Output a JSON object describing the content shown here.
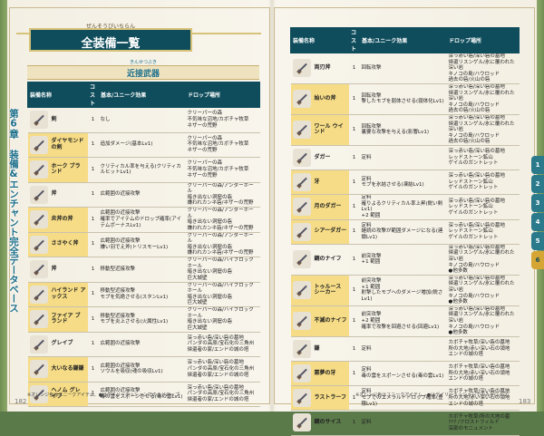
{
  "chapter_label": "第6章 装備&エンチャント完全データベース",
  "title": {
    "ruby": "ぜんそうびいちらん",
    "text": "全装備一覧"
  },
  "section": {
    "ruby": "きんせつぶき",
    "text": "近接武器"
  },
  "headers": [
    "装備名称",
    "コスト",
    "基本/ユニーク効果",
    "ドロップ場所"
  ],
  "left_rows": [
    {
      "name": "剣",
      "cost": "1",
      "effect": "なし",
      "drop": "クリーパーの森\n不気味な沼地/カボチャ牧草\nネザーの荒野",
      "hl": false
    },
    {
      "name": "ダイヤモンドの剣",
      "cost": "1",
      "effect": "追加ダメージ(基本Lv1)",
      "drop": "クリーパーの森\n不気味な沼地/カボチャ牧草\nネザーの荒野",
      "hl": true
    },
    {
      "name": "ホーク ブランド",
      "cost": "1",
      "effect": "クリティカル率を与える(クリティカルヒットLv1)",
      "drop": "クリーパーの森\n不気味な沼地/カボチャ牧草\nネザーの荒野",
      "hl": true
    },
    {
      "name": "斧",
      "cost": "1",
      "effect": "広範囲の近接攻撃",
      "drop": "クリーパーの森/アンダーホール\n暗き出ない洞窟の砦\n嫌われカンネ砦/ネザーの荒野",
      "hl": false
    },
    {
      "name": "炎斧の斧",
      "cost": "1",
      "effect": "広範囲の近接攻撃\n確率でアイテムのドロップ確率(アイテムボーナスLv1)",
      "drop": "クリーパーの森/アンダーホール\n暗き出ない洞窟の砦\n嫌われカンネ砦/ネザーの荒野",
      "hl": true
    },
    {
      "name": "ささやく斧",
      "cost": "1",
      "effect": "広範囲の近接攻撃\n嫌い羽でえ斧(トリスモーLv1)",
      "drop": "クリーパーの森/アンダーホール\n暗き出ない洞窟の砦\n嫌われカンネ砦/ネザーの荒野",
      "hl": true
    },
    {
      "name": "斧",
      "cost": "1",
      "effect": "移動型近接攻撃",
      "drop": "クリーパーの森/ハイブロックホール\n暗き出ない洞窟の砦\n巨大城壁",
      "hl": false
    },
    {
      "name": "ハイランド アックス",
      "cost": "1",
      "effect": "移動型近接攻撃\nモブを気絶させる(スタンLv1)",
      "drop": "クリーパーの森/ハイブロックホール\n暗き出ない洞窟の砦\n巨大城壁",
      "hl": true
    },
    {
      "name": "ファイア ブランド",
      "cost": "1",
      "effect": "移動型近接攻撃\nモブを炎上させる(火属性Lv1)",
      "drop": "クリーパーの森/ハイブロックホール\n暗き出ない洞窟の砦\n巨大城壁",
      "hl": true
    },
    {
      "name": "グレイブ",
      "cost": "1",
      "effect": "広範囲の近接攻撃",
      "drop": "深っ赤い砦/深い砦の墓地\nパンダの高原/宝石化の三角州\n帰還者の家/エンドの城の塔",
      "hl": false
    },
    {
      "name": "大いなる鎌鎌",
      "cost": "1",
      "effect": "広範囲の近接攻撃\nソウルを吸収(魂の吸収Lv1)",
      "drop": "深っ赤い砦/深い砦の墓地\nパンダの高原/宝石化の三角州\n帰還者の家/エンドの城の塔",
      "hl": true
    },
    {
      "name": "ヘノム グレイブ",
      "cost": "1",
      "effect": "広範囲の近接攻撃\n毒の雲をスポーンさせる(毒の雲Lv1)",
      "drop": "深っ赤い砦/深い砦の墓地\nパンダの高原/宝石化の三角州\n帰還者の家/エンドの城の塔",
      "hl": true
    }
  ],
  "right_rows": [
    {
      "name": "両刃斧",
      "cost": "1",
      "effect": "回転攻撃",
      "drop": "深っ赤い砦/深い砦の墓地\n帰還リスンゲル/氷に覆われた深い岩\nキノコの島/ハウロッド\n過去の砦/火山の砦",
      "hl": false
    },
    {
      "name": "始いの斧",
      "cost": "1",
      "effect": "回転攻撃\n撃したモブを弱体させる(弱体化Lv1)",
      "drop": "深っ赤い砦/深い砦の墓地\n帰還リスンゲル/氷に覆われた深い岩\nキノコの島/ハウロッド\n過去の砦/火山の砦",
      "hl": true
    },
    {
      "name": "ワール ウインド",
      "cost": "1",
      "effect": "回転攻撃\n裏要な攻撃を与える(影響Lv1)",
      "drop": "深っ赤い砦/深い砦の墓地\n帰還リスンゲル/氷に覆われた深い岩\nキノコの島/ハウロッド\n過去の砦/火山の砦",
      "hl": true
    },
    {
      "name": "ダガー",
      "cost": "1",
      "effect": "定料",
      "drop": "深っ赤い砦/深い砦の墓地\nレッドストーン鉱山\nゲイルのガントレット",
      "hl": false
    },
    {
      "name": "牙",
      "cost": "1",
      "effect": "定料\nモブを氷結させる(凍結Lv1)",
      "drop": "深っ赤い砦/深い砦の墓地\nレッドストーン鉱山\nゲイルのガントレット",
      "hl": true
    },
    {
      "name": "月のダガー",
      "cost": "1",
      "effect": "定料\n確りよるクリティカル率上昇(鋭い剣Lv1)\n+2 範囲",
      "drop": "深っ赤い砦/深い砦の墓地\nレッドストーン鉱山\nゲイルのガントレット",
      "hl": true
    },
    {
      "name": "シアーダガー",
      "cost": "1",
      "effect": "定料\n継続の攻撃が範囲ダメージになる(連鎖Lv1)",
      "drop": "深っ赤い砦/深い砦の墓地\nレッドストーン鉱山\nゲイルのガントレット",
      "hl": true
    },
    {
      "name": "鋼のナイフ",
      "cost": "1",
      "effect": "前突攻撃\n+1 範囲",
      "drop": "深っ赤い砦/深い砦の墓地\n帰還リスンゲル/氷に覆われた深い岩\nキノコの島/ハウロッド\n●他多数",
      "hl": false
    },
    {
      "name": "トゥルース シーカー",
      "cost": "1",
      "effect": "前突攻撃\n+1 範囲\n射撃したモブへのダメージ増加(鋭さLv1)",
      "drop": "深っ赤い砦/深い砦の墓地\n帰還リスンゲル/氷に覆われた深い岩\nキノコの島/ハウロッド\n●他多数",
      "hl": true
    },
    {
      "name": "不滅のナイフ",
      "cost": "1",
      "effect": "前突攻撃\n+2 範囲\n確率で攻撃を回避させる(回避Lv1)",
      "drop": "深っ赤い砦/深い砦の墓地\n帰還リスンゲル/氷に覆われた深い岩\nキノコの島/ハウロッド\n●他多数",
      "hl": true
    },
    {
      "name": "鎌",
      "cost": "1",
      "effect": "定料",
      "drop": "カボチャ牧草/深い砦の墓地\n所の大地/赤い深い石の領地\nエンドの城の塔",
      "hl": false
    },
    {
      "name": "悪夢の牙",
      "cost": "1",
      "effect": "定料\n毒の雲をスポーンさせる(毒の雲Lv1)",
      "drop": "カボチャ牧草/深い砦の墓地\n所の大地/赤い深い石の領地\nエンドの城の塔",
      "hl": true
    },
    {
      "name": "ラストラーフ",
      "cost": "1",
      "effect": "定料\nモブでのエメラルドドロップ確率(豊穣Lv1)",
      "drop": "カボチャ牧草/深い砦の墓地\n所の大地/赤い深い石の領地\nエンドの城の塔",
      "hl": true
    },
    {
      "name": "鋼のサイス",
      "cost": "1",
      "effect": "定料",
      "drop": "カボチャ牧草/所の大地の墓\n??? /フロストフィルド\n深部のモニュメント",
      "hl": false
    }
  ],
  "note_left": "※オレンジ色はユニークアイテム、●はデイリーミッションでのみドロップ",
  "note_right": "※オレンジ色はユニークアイテム、●はデイリーミッションでのみドロップ",
  "page_left": "182",
  "page_right": "183",
  "tabs": [
    "1",
    "2",
    "3",
    "4",
    "5",
    "6"
  ],
  "active_tab": "6"
}
